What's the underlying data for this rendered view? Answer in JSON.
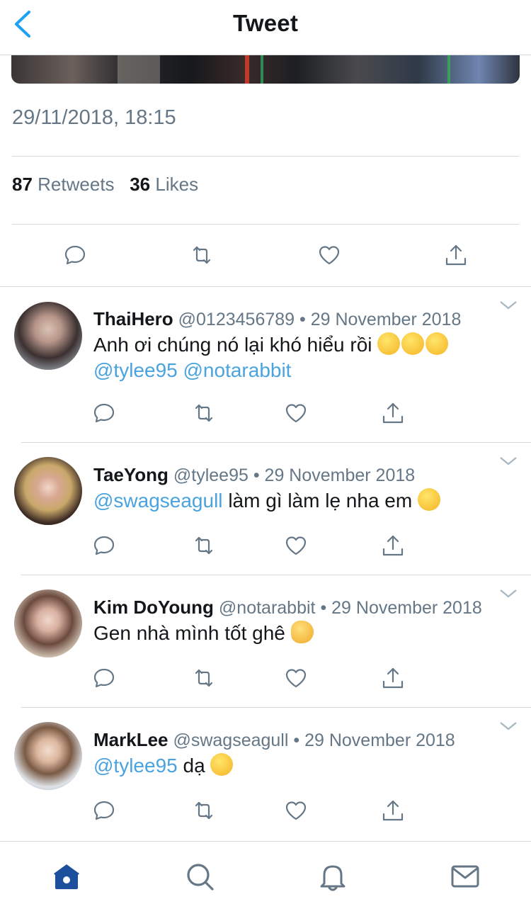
{
  "header": {
    "title": "Tweet"
  },
  "tweet": {
    "timestamp": "29/11/2018, 18:15",
    "retweets_count": "87",
    "retweets_label": "Retweets",
    "likes_count": "36",
    "likes_label": "Likes"
  },
  "replies": [
    {
      "name": "ThaiHero",
      "handle": "@0123456789",
      "date": "• 29 November 2018",
      "text": "Anh ơi chúng nó lại khó hiểu rồi",
      "mention1": "@tylee95",
      "mention2": "@notarabbit",
      "emoji": "sneezing-face-emoji"
    },
    {
      "name": "TaeYong",
      "handle": "@tylee95",
      "date": "• 29 November 2018",
      "mention": "@swagseagull",
      "text": "làm gì làm lẹ nha em",
      "emoji": "slightly-smiling-face-emoji"
    },
    {
      "name": "Kim DoYoung",
      "handle": "@notarabbit",
      "date": "• 29 November 2018",
      "text": "Gen nhà mình tốt ghê",
      "emoji": "ok-hand-emoji"
    },
    {
      "name": "MarkLee",
      "handle": "@swagseagull",
      "date": "• 29 November 2018",
      "mention": "@tylee95",
      "text": "dạ",
      "emoji": "smiling-face-emoji"
    }
  ],
  "colors": {
    "accent": "#1da1f2",
    "mention": "#4aa3df",
    "secondary_text": "#657786",
    "tab_active": "#1c4f9c",
    "divider": "#d6d9dc"
  },
  "tabbar": {
    "items": [
      "home-icon",
      "search-icon",
      "notifications-icon",
      "messages-icon"
    ],
    "active": "home-icon"
  }
}
